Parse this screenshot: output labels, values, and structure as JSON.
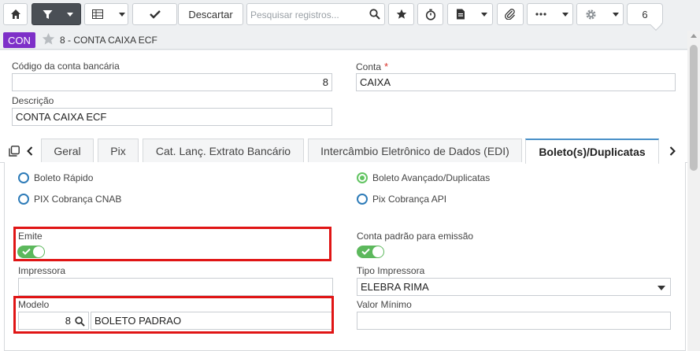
{
  "toolbar": {
    "home_icon": "home-icon",
    "filter_icon": "filter-icon",
    "grid_icon": "grid-icon",
    "save_icon": "checkmark-icon",
    "discard_label": "Descartar",
    "search_placeholder": "Pesquisar registros...",
    "search_icon": "search-icon",
    "favorite_icon": "star-icon",
    "timer_icon": "stopwatch-icon",
    "report_icon": "document-icon",
    "attach_icon": "paperclip-icon",
    "more_icon": "ellipsis-icon",
    "settings_icon": "gear-icon",
    "count": "6"
  },
  "titlebar": {
    "entity_badge": "CON",
    "record_title": "8 - CONTA CAIXA ECF",
    "badge_color": "#7e2fc8"
  },
  "form": {
    "codigo_label": "Código da conta bancária",
    "codigo_value": "8",
    "conta_label": "Conta",
    "conta_required": "*",
    "conta_value": "CAIXA",
    "descricao_label": "Descrição",
    "descricao_value": "CONTA CAIXA ECF"
  },
  "tabs": [
    {
      "label": "Geral"
    },
    {
      "label": "Pix"
    },
    {
      "label": "Cat. Lanç. Extrato Bancário"
    },
    {
      "label": "Intercâmbio Eletrônico de Dados (EDI)"
    },
    {
      "label": "Boleto(s)/Duplicatas",
      "active": true
    }
  ],
  "boleto": {
    "radio_boleto_rapido": "Boleto Rápido",
    "radio_boleto_avancado": "Boleto Avançado/Duplicatas",
    "radio_pix_cnab": "PIX Cobrança CNAB",
    "radio_pix_api": "Pix Cobrança API",
    "selected_radio": "Boleto Avançado/Duplicatas",
    "emite_label": "Emite",
    "emite_on": true,
    "conta_padrao_label": "Conta padrão para emissão",
    "conta_padrao_on": true,
    "impressora_label": "Impressora",
    "impressora_value": "",
    "tipo_impressora_label": "Tipo Impressora",
    "tipo_impressora_value": "ELEBRA RIMA",
    "modelo_label": "Modelo",
    "modelo_code": "8",
    "modelo_desc": "BOLETO PADRAO",
    "valor_minimo_label": "Valor Mínimo",
    "valor_minimo_value": "",
    "highlight_color": "#e01515",
    "toggle_color": "#5cb85c"
  }
}
